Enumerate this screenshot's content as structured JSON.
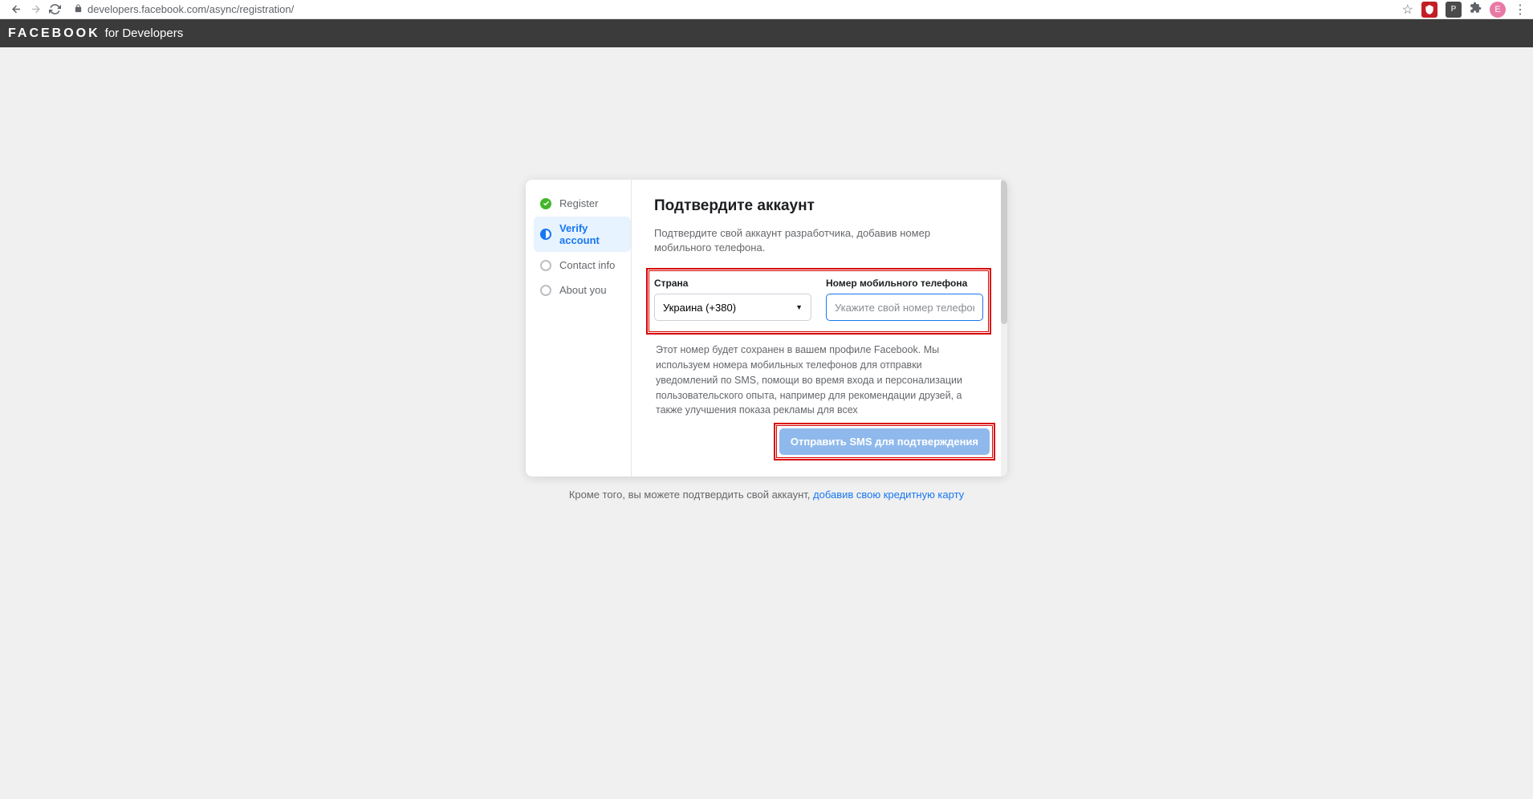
{
  "browser": {
    "url": "developers.facebook.com/async/registration/",
    "avatar_letter": "E"
  },
  "header": {
    "brand": "FACEBOOK",
    "sub": "for Developers"
  },
  "sidebar": {
    "steps": [
      {
        "label": "Register"
      },
      {
        "label": "Verify account"
      },
      {
        "label": "Contact info"
      },
      {
        "label": "About you"
      }
    ]
  },
  "content": {
    "title": "Подтвердите аккаунт",
    "subtitle": "Подтвердите свой аккаунт разработчика, добавив номер мобильного телефона.",
    "country_label": "Страна",
    "country_value": "Украина (+380)",
    "phone_label": "Номер мобильного телефона",
    "phone_placeholder": "Укажите свой номер телефона",
    "helper": "Этот номер будет сохранен в вашем профиле Facebook. Мы используем номера мобильных телефонов для отправки уведомлений по SMS, помощи во время входа и персонализации пользовательского опыта, например для рекомендации друзей, а также улучшения показа рекламы для всех",
    "submit": "Отправить SMS для подтверждения",
    "below_text": "Кроме того, вы можете подтвердить свой аккаунт, ",
    "below_link": "добавив свою кредитную карту"
  }
}
